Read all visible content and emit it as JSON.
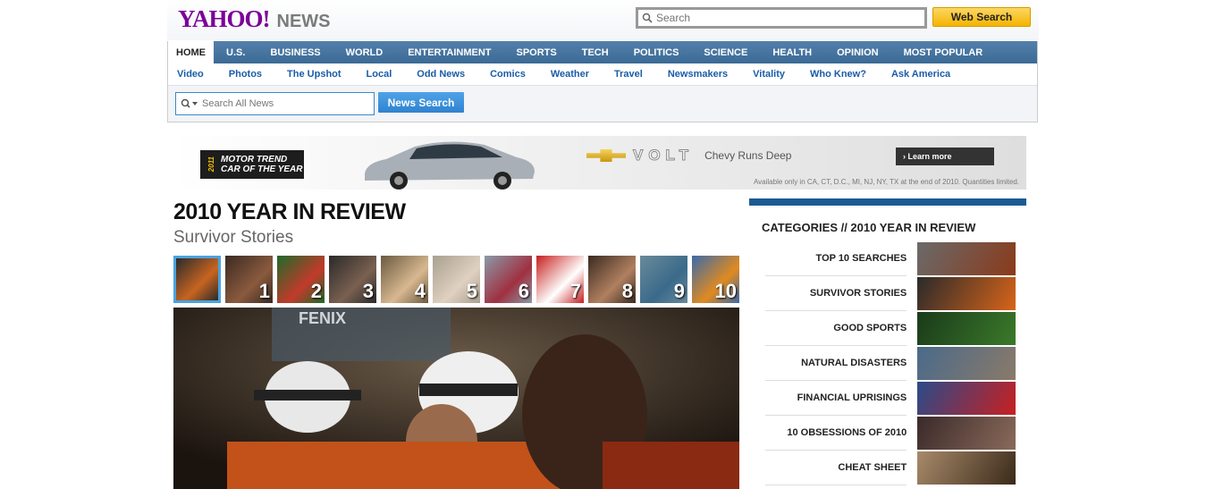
{
  "header": {
    "logo_text": "YAHOO!",
    "logo_sub": "NEWS",
    "web_search_placeholder": "Search",
    "web_search_button": "Web Search"
  },
  "main_nav": [
    "HOME",
    "U.S.",
    "BUSINESS",
    "WORLD",
    "ENTERTAINMENT",
    "SPORTS",
    "TECH",
    "POLITICS",
    "SCIENCE",
    "HEALTH",
    "OPINION",
    "MOST POPULAR"
  ],
  "sub_nav": [
    "Video",
    "Photos",
    "The Upshot",
    "Local",
    "Odd News",
    "Comics",
    "Weather",
    "Travel",
    "Newsmakers",
    "Vitality",
    "Who Knew?",
    "Ask America"
  ],
  "news_search": {
    "placeholder": "Search All News",
    "button": "News Search"
  },
  "ad": {
    "badge_year": "2011",
    "badge_text": "MOTOR TREND CAR OF THE YEAR",
    "brand": "VOLT",
    "tagline": "Chevy Runs Deep",
    "cta": "Learn more",
    "fineprint": "Available only in CA, CT, D.C., MI, NJ, NY, TX at the end of 2010. Quantities limited."
  },
  "article": {
    "title": "2010 YEAR IN REVIEW",
    "subtitle": "Survivor Stories",
    "thumbnails": [
      "",
      "1",
      "2",
      "3",
      "4",
      "5",
      "6",
      "7",
      "8",
      "9",
      "10"
    ]
  },
  "sidebar": {
    "heading": "CATEGORIES // 2010 YEAR IN REVIEW",
    "categories": [
      "TOP 10 SEARCHES",
      "SURVIVOR STORIES",
      "GOOD SPORTS",
      "NATURAL DISASTERS",
      "FINANCIAL UPRISINGS",
      "10 OBSESSIONS OF 2010",
      "CHEAT SHEET"
    ]
  },
  "colors": {
    "brand_purple": "#7b0099",
    "nav_blue": "#3b6a96",
    "link_blue": "#1a5ca8",
    "accent_blue": "#1d5a92"
  }
}
